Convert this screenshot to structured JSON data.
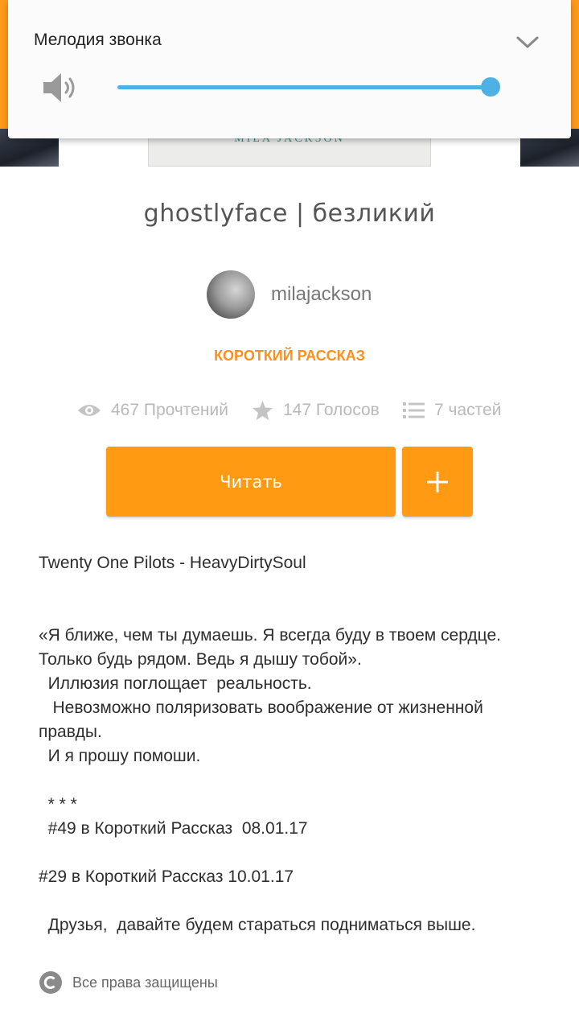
{
  "volume_popup": {
    "title": "Мелодия звонка",
    "level": 1.0,
    "accent_color": "#4db1e6",
    "icons": [
      "speaker-icon",
      "chevron-down-icon"
    ]
  },
  "cover": {
    "text": "MILA JACKSON"
  },
  "story": {
    "title": "ghostlyface | безликий",
    "author": "milajackson",
    "type": "КОРОТКИЙ РАССКАЗ",
    "stats": {
      "reads": "467 Прочтений",
      "votes": "147 Голосов",
      "parts": "7 частей"
    },
    "read_button": "Читать",
    "add_button_icon": "plus-icon",
    "accent_color": "#ff9a12"
  },
  "description": {
    "lines": [
      "Twenty One Pilots - HeavyDirtySoul",
      "«Я ближе, чем ты думаешь. Я всегда буду в твоем сердце.",
      "Только будь рядом. Ведь я дышу тобой».",
      "  Иллюзия поглощает  реальность.",
      "   Невозможно поляризовать воображение от жизненной",
      "правды.",
      "  И я прошу помоши.",
      "  * * *",
      "  #49 в Короткий Рассказ  08.01.17",
      "#29 в Короткий Рассказ 10.01.17",
      "  Друзья,  давайте будем стараться подниматься выше."
    ]
  },
  "copyright": {
    "text": "Все права защищены"
  }
}
